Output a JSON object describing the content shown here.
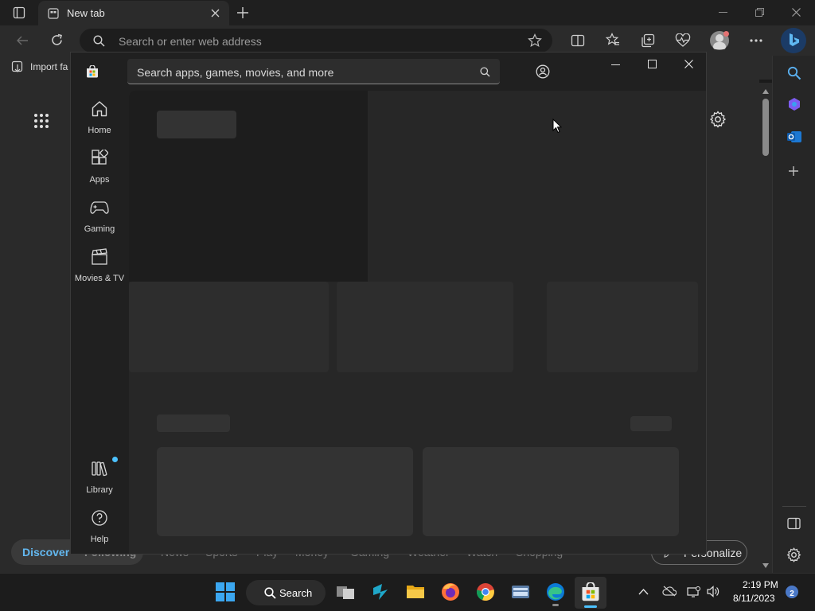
{
  "browser": {
    "tab_title": "New tab",
    "address_placeholder": "Search or enter web address",
    "favorites_label": "Import fa"
  },
  "ntp": {
    "feed_tabs": [
      {
        "label": "Discover"
      },
      {
        "label": "Following"
      },
      {
        "label": "News"
      },
      {
        "label": "Sports"
      },
      {
        "label": "Play"
      },
      {
        "label": "Money"
      },
      {
        "label": "Gaming"
      },
      {
        "label": "Weather"
      },
      {
        "label": "Watch"
      },
      {
        "label": "Shopping"
      }
    ],
    "personalize_label": "Personalize"
  },
  "store": {
    "search_placeholder": "Search apps, games, movies, and more",
    "nav": [
      {
        "label": "Home",
        "icon": "home-icon"
      },
      {
        "label": "Apps",
        "icon": "apps-icon"
      },
      {
        "label": "Gaming",
        "icon": "gamepad-icon"
      },
      {
        "label": "Movies & TV",
        "icon": "clapperboard-icon"
      }
    ],
    "nav_bottom": [
      {
        "label": "Library",
        "icon": "library-icon"
      },
      {
        "label": "Help",
        "icon": "help-icon"
      }
    ]
  },
  "taskbar": {
    "search_label": "Search",
    "time": "2:19 PM",
    "date": "8/11/2023",
    "notification_count": "2"
  },
  "colors": {
    "accent": "#4cc2ff",
    "taskbar_bg": "#1c1c1c",
    "window_bg": "#202020"
  }
}
